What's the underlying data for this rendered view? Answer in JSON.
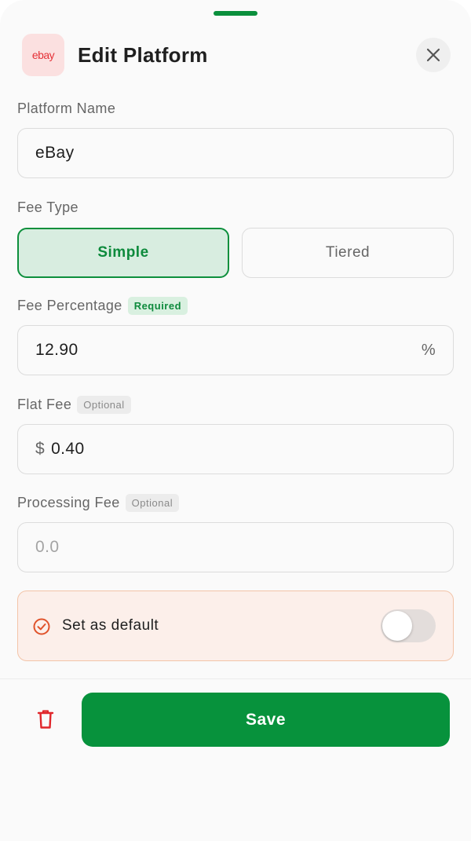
{
  "header": {
    "logo_text": "ebay",
    "title": "Edit Platform",
    "close_icon": "close-icon"
  },
  "platform_name": {
    "label": "Platform Name",
    "value": "eBay"
  },
  "fee_type": {
    "label": "Fee Type",
    "options": [
      "Simple",
      "Tiered"
    ],
    "selected": "Simple"
  },
  "fee_percentage": {
    "label": "Fee Percentage",
    "badge": "Required",
    "value": "12.90",
    "suffix": "%"
  },
  "flat_fee": {
    "label": "Flat Fee",
    "badge": "Optional",
    "prefix": "$",
    "value": "0.40"
  },
  "processing_fee": {
    "label": "Processing Fee",
    "badge": "Optional",
    "placeholder": "0.0"
  },
  "default_setting": {
    "label": "Set as default",
    "enabled": false,
    "icon": "check-circle-icon"
  },
  "footer": {
    "delete_icon": "trash-icon",
    "save_label": "Save"
  },
  "colors": {
    "accent": "#07923c",
    "danger": "#e0262b",
    "default_card_bg": "#fcefea",
    "default_card_border": "#f3c4a8"
  }
}
